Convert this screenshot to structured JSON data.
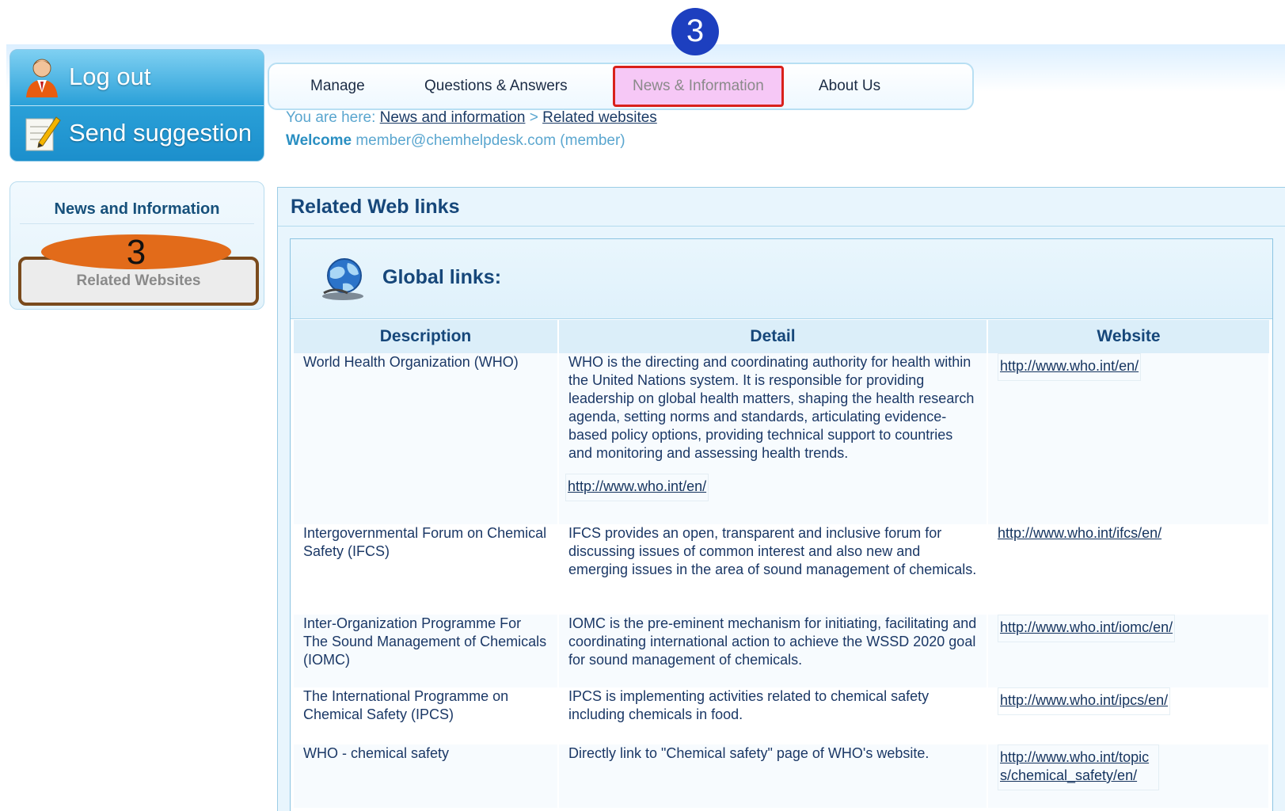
{
  "actions": {
    "logout_label": "Log out",
    "suggestion_label": "Send suggestion"
  },
  "sidebar": {
    "title": "News and Information",
    "items": [
      {
        "label": "Related Websites"
      }
    ],
    "step_marker": "3"
  },
  "nav": {
    "items": [
      {
        "label": "Manage"
      },
      {
        "label": "Questions & Answers"
      },
      {
        "label": "News & Information"
      },
      {
        "label": "About Us"
      }
    ],
    "step_marker": "3"
  },
  "breadcrumb": {
    "prefix": "You are here:",
    "items": [
      "News and information",
      "Related websites"
    ],
    "separator": ">"
  },
  "welcome": {
    "label": "Welcome",
    "user": "member@chemhelpdesk.com (member)"
  },
  "main": {
    "title": "Related Web links",
    "section_title": "Global links:",
    "columns": [
      "Description",
      "Detail",
      "Website"
    ],
    "rows": [
      {
        "description": "World Health Organization (WHO)",
        "detail": "WHO is the directing and coordinating authority for health within the United Nations system. It is responsible for providing leadership on global health matters, shaping the health research agenda, setting norms and standards, articulating evidence-based policy options, providing technical support to countries and monitoring and assessing health trends.",
        "detail_link": "http://www.who.int/en/",
        "website": "http://www.who.int/en/"
      },
      {
        "description": "Intergovernmental Forum on Chemical Safety (IFCS)",
        "detail": "IFCS provides an open, transparent and inclusive forum for discussing issues of common interest and also new and emerging issues in the area of sound management of chemicals.",
        "website": "http://www.who.int/ifcs/en/"
      },
      {
        "description": "Inter-Organization Programme For The Sound Management of Chemicals (IOMC)",
        "detail": "IOMC is the pre-eminent mechanism for initiating, facilitating and coordinating international action to achieve the WSSD 2020 goal for sound management of chemicals.",
        "website": "http://www.who.int/iomc/en/"
      },
      {
        "description": "The International Programme on Chemical Safety (IPCS)",
        "detail": "IPCS is implementing activities related to chemical safety including chemicals in food.",
        "website": "http://www.who.int/ipcs/en/"
      },
      {
        "description": "WHO - chemical safety",
        "detail": "Directly link to \"Chemical safety\" page of WHO's website.",
        "website": "http://www.who.int/topics/chemical_safety/en/"
      }
    ]
  },
  "colors": {
    "accent_blue": "#2aa0d8",
    "title_navy": "#16477a",
    "highlight_red": "#d9211b",
    "highlight_pink": "#f6c8f6",
    "marker_orange": "#e26b1a",
    "marker_blue": "#1d3fbf",
    "outline_brown": "#7a4a1c"
  }
}
